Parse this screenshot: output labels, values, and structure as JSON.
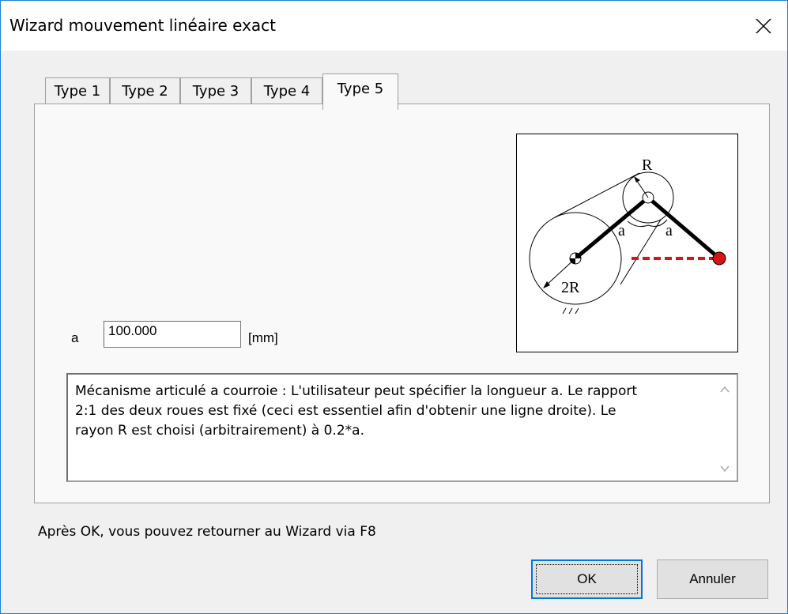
{
  "window": {
    "title": "Wizard mouvement linéaire exact"
  },
  "tabs": [
    {
      "label": "Type 1"
    },
    {
      "label": "Type 2"
    },
    {
      "label": "Type 3"
    },
    {
      "label": "Type 4"
    },
    {
      "label": "Type 5",
      "selected": true
    }
  ],
  "form": {
    "a_label": "a",
    "a_value": "100.000",
    "unit": "[mm]"
  },
  "diagram": {
    "label_R": "R",
    "label_a_left": "a",
    "label_a_right": "a",
    "label_2R": "2R",
    "accent_color": "#d91414"
  },
  "description": {
    "line1": "Mécanisme articulé a courroie : L'utilisateur peut spécifier la longueur a. Le rapport",
    "line2": "2:1 des deux roues est fixé (ceci est essentiel afin d'obtenir une ligne droite). Le",
    "line3": "rayon R est choisi (arbitrairement) à 0.2*a."
  },
  "footer": {
    "hint": "Après OK, vous pouvez retourner au Wizard via F8",
    "ok_label": "OK",
    "cancel_label": "Annuler"
  },
  "colors": {
    "accent_border": "#0078d7",
    "window_border": "#1883d7"
  }
}
